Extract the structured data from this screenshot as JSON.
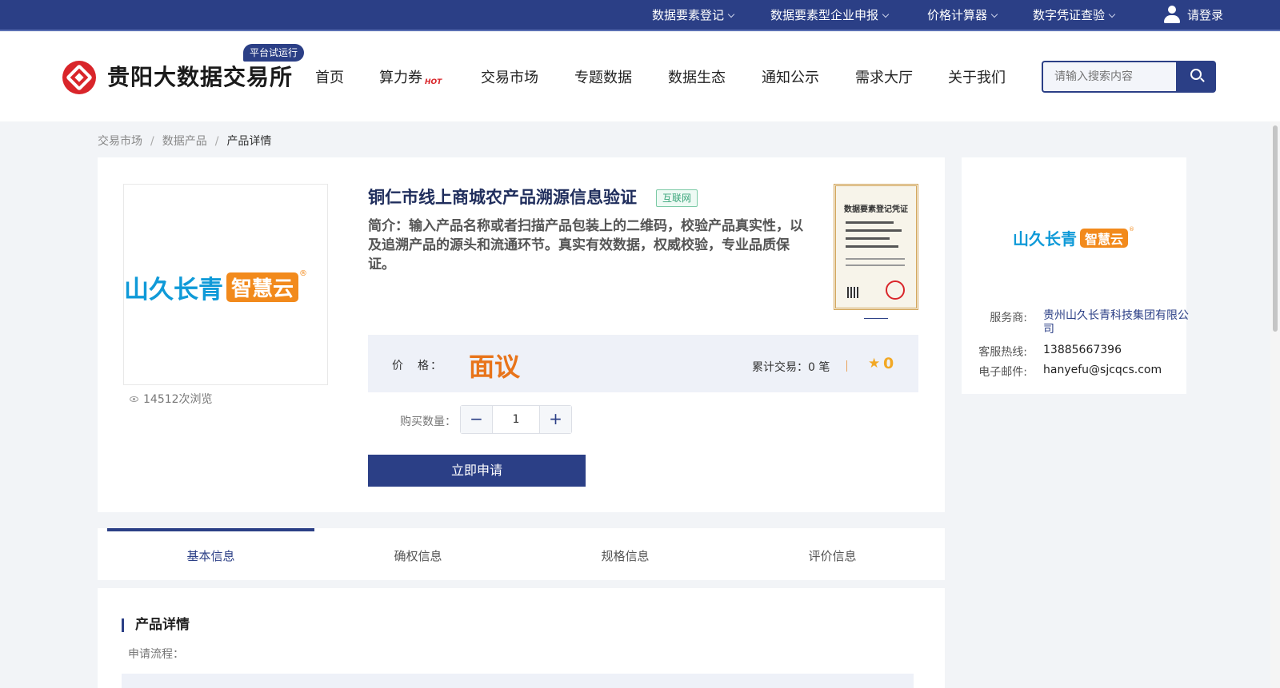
{
  "topbar": {
    "items": [
      {
        "label": "数据要素登记"
      },
      {
        "label": "数据要素型企业申报"
      },
      {
        "label": "价格计算器"
      },
      {
        "label": "数字凭证查验"
      }
    ],
    "login": "请登录"
  },
  "header": {
    "site_title": "贵阳大数据交易所",
    "badge": "平台试运行",
    "nav": [
      "首页",
      "算力券",
      "交易市场",
      "专题数据",
      "数据生态",
      "通知公示",
      "需求大厅",
      "关于我们"
    ],
    "hot_tag": "HOT",
    "search_placeholder": "请输入搜索内容"
  },
  "breadcrumb": [
    "交易市场",
    "数据产品",
    "产品详情"
  ],
  "product": {
    "brand_cn": "山久长青",
    "brand_box": "智慧云",
    "title": "铜仁市线上商城农产品溯源信息验证",
    "tag": "互联网",
    "intro": "简介：输入产品名称或者扫描产品包装上的二维码，校验产品真实性，以及追溯产品的源头和流通环节。真实有效数据，权威校验，专业品质保证。",
    "views": "14512次浏览",
    "certificate_title": "数据要素登记凭证",
    "price_label": "价　格：",
    "price_value": "面议",
    "trade_count": "累计交易：0 笔",
    "rating": "0",
    "qty_label": "购买数量：",
    "qty_value": "1",
    "apply_button": "立即申请"
  },
  "provider": {
    "service_label": "服务商:",
    "service_value": "贵州山久长青科技集团有限公司",
    "hotline_label": "客服热线:",
    "hotline_value": "13885667396",
    "email_label": "电子邮件:",
    "email_value": "hanyefu@sjcqcs.com"
  },
  "tabs": [
    "基本信息",
    "确权信息",
    "规格信息",
    "评价信息"
  ],
  "details": {
    "heading": "产品详情",
    "apply_flow": "申请流程："
  },
  "colors": {
    "brand_navy": "#2b3f86",
    "price_orange": "#e8741a",
    "logo_red": "#d9252a"
  }
}
